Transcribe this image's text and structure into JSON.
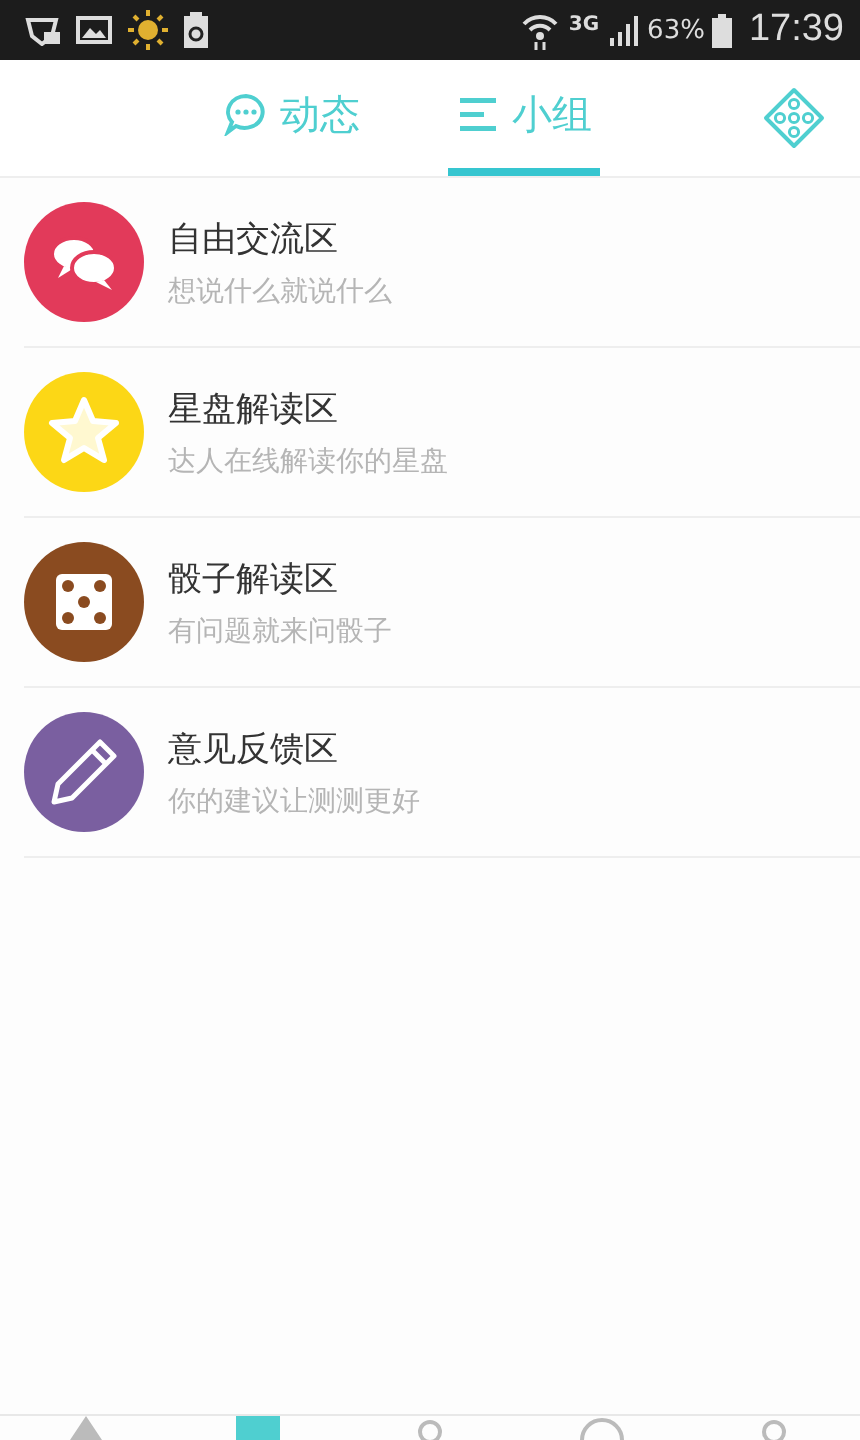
{
  "status_bar": {
    "network": "3G",
    "battery": "63%",
    "time": "17:39"
  },
  "tabs": [
    {
      "label": "动态",
      "kind": "chat",
      "selected": false
    },
    {
      "label": "小组",
      "kind": "list",
      "selected": true
    }
  ],
  "groups": [
    {
      "title": "自由交流区",
      "subtitle": "想说什么就说什么",
      "kind": "chat",
      "color": "#e23a5a"
    },
    {
      "title": "星盘解读区",
      "subtitle": "达人在线解读你的星盘",
      "kind": "star",
      "color": "#fcd716"
    },
    {
      "title": "骰子解读区",
      "subtitle": "有问题就来问骰子",
      "kind": "dice",
      "color": "#8a4b20"
    },
    {
      "title": "意见反馈区",
      "subtitle": "你的建议让测测更好",
      "kind": "pencil",
      "color": "#7a5fa0"
    }
  ]
}
